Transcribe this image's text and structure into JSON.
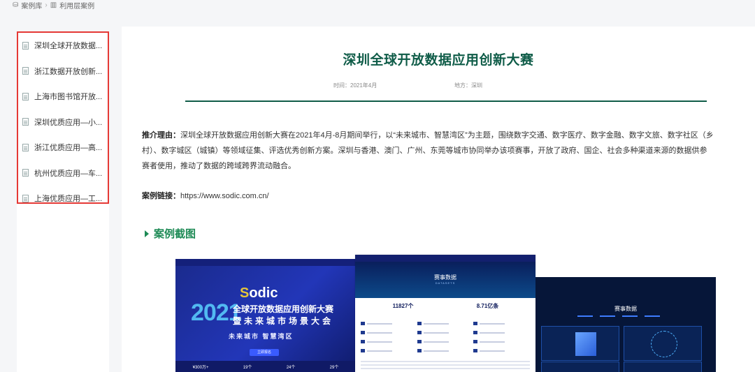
{
  "breadcrumb": {
    "root": "案例库",
    "current": "利用层案例"
  },
  "sidebar": {
    "items": [
      {
        "label": "深圳全球开放数据..."
      },
      {
        "label": "浙江数据开放创新..."
      },
      {
        "label": "上海市图书馆开放..."
      },
      {
        "label": "深圳优质应用—小..."
      },
      {
        "label": "浙江优质应用—高..."
      },
      {
        "label": "杭州优质应用—车..."
      },
      {
        "label": "上海优质应用—工..."
      }
    ]
  },
  "article": {
    "title": "深圳全球开放数据应用创新大赛",
    "time": "时间：2021年4月",
    "place": "地方：深圳",
    "reason_label": "推介理由：",
    "reason_text": "深圳全球开放数据应用创新大赛在2021年4月-8月期间举行，以“未来城市、智慧湾区”为主题，围绕数字交通、数字医疗、数字金融、数字文旅、数字社区（乡村）、数字城区（城镇）等领域征集、评选优秀创新方案。深圳与香港、澳门、广州、东莞等城市协同举办该项赛事，开放了政府、国企、社会多种渠道来源的数据供参赛者使用，推动了数据的跨域跨界流动融合。",
    "link_label": "案例链接：",
    "link_url": "https://www.sodic.com.cn/",
    "section_title": "案例截图"
  },
  "screenshots": {
    "s1": {
      "logo": "Sodic",
      "year": "2021",
      "headline1": "全球开放数据应用创新大赛",
      "headline2": "暨未来城市场景大会",
      "tagline": "未来城市  智慧湾区",
      "button": "立即报名",
      "stats": [
        "¥300万+",
        "19个",
        "24个",
        "29个"
      ]
    },
    "s2": {
      "title": "赛事数据",
      "subtitle": "DATASETS",
      "num1": "11827个",
      "num2": "8.71亿条"
    },
    "s3": {
      "title": "赛事数据"
    }
  }
}
